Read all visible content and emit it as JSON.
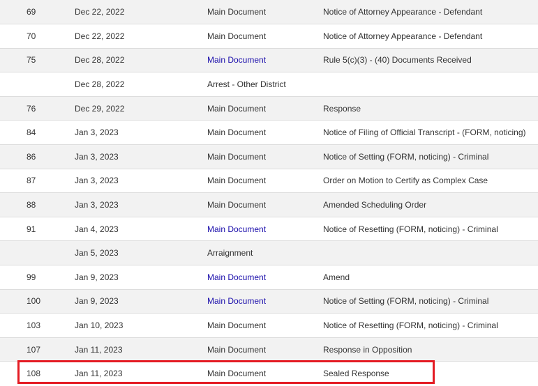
{
  "docket": {
    "rows": [
      {
        "num": "69",
        "date": "Dec 22, 2022",
        "doc": "Main Document",
        "doc_link": false,
        "desc": "Notice of Attorney Appearance - Defendant"
      },
      {
        "num": "70",
        "date": "Dec 22, 2022",
        "doc": "Main Document",
        "doc_link": false,
        "desc": "Notice of Attorney Appearance - Defendant"
      },
      {
        "num": "75",
        "date": "Dec 28, 2022",
        "doc": "Main Document",
        "doc_link": true,
        "desc": "Rule 5(c)(3) - (40) Documents Received"
      },
      {
        "num": "",
        "date": "Dec 28, 2022",
        "doc": "Arrest - Other District",
        "doc_link": false,
        "desc": ""
      },
      {
        "num": "76",
        "date": "Dec 29, 2022",
        "doc": "Main Document",
        "doc_link": false,
        "desc": "Response"
      },
      {
        "num": "84",
        "date": "Jan 3, 2023",
        "doc": "Main Document",
        "doc_link": false,
        "desc": "Notice of Filing of Official Transcript - (FORM, noticing)"
      },
      {
        "num": "86",
        "date": "Jan 3, 2023",
        "doc": "Main Document",
        "doc_link": false,
        "desc": "Notice of Setting (FORM, noticing) - Criminal"
      },
      {
        "num": "87",
        "date": "Jan 3, 2023",
        "doc": "Main Document",
        "doc_link": false,
        "desc": "Order on Motion to Certify as Complex Case"
      },
      {
        "num": "88",
        "date": "Jan 3, 2023",
        "doc": "Main Document",
        "doc_link": false,
        "desc": "Amended Scheduling Order"
      },
      {
        "num": "91",
        "date": "Jan 4, 2023",
        "doc": "Main Document",
        "doc_link": true,
        "desc": "Notice of Resetting (FORM, noticing) - Criminal"
      },
      {
        "num": "",
        "date": "Jan 5, 2023",
        "doc": "Arraignment",
        "doc_link": false,
        "desc": ""
      },
      {
        "num": "99",
        "date": "Jan 9, 2023",
        "doc": "Main Document",
        "doc_link": true,
        "desc": "Amend"
      },
      {
        "num": "100",
        "date": "Jan 9, 2023",
        "doc": "Main Document",
        "doc_link": true,
        "desc": "Notice of Setting (FORM, noticing) - Criminal"
      },
      {
        "num": "103",
        "date": "Jan 10, 2023",
        "doc": "Main Document",
        "doc_link": false,
        "desc": "Notice of Resetting (FORM, noticing) - Criminal"
      },
      {
        "num": "107",
        "date": "Jan 11, 2023",
        "doc": "Main Document",
        "doc_link": false,
        "desc": "Response in Opposition"
      },
      {
        "num": "108",
        "date": "Jan 11, 2023",
        "doc": "Main Document",
        "doc_link": false,
        "desc": "Sealed Response"
      }
    ]
  },
  "colors": {
    "link": "#1a0dab",
    "text": "#333333",
    "stripe": "#f2f2f2",
    "highlight": "#e41b23"
  }
}
